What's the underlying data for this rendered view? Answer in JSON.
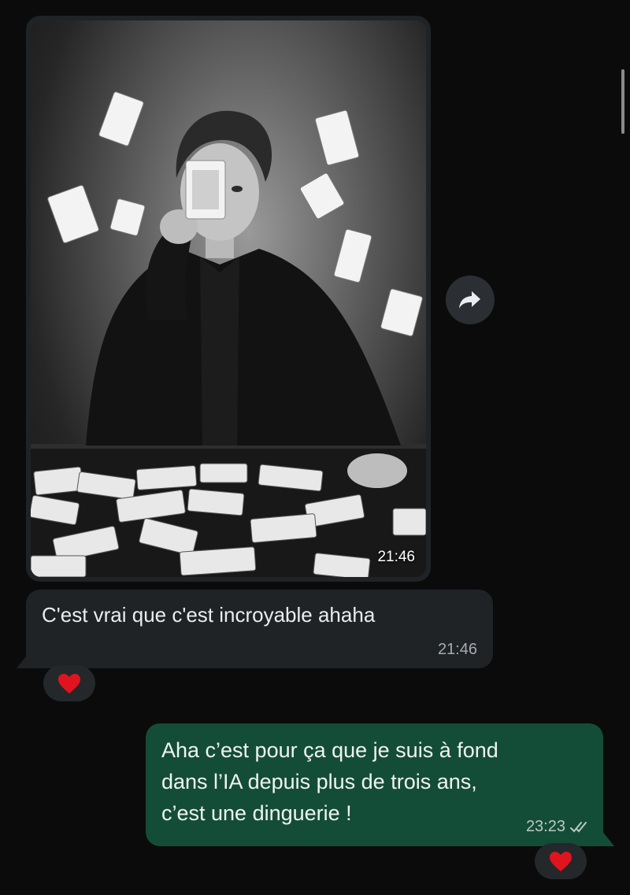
{
  "image_message": {
    "time": "21:46"
  },
  "received_message": {
    "text": "C'est vrai que c'est incroyable ahaha",
    "time": "21:46",
    "reaction": "❤️"
  },
  "sent_message": {
    "lines": [
      "Aha c’est pour ça que je suis à fond",
      "dans l’IA depuis plus de trois ans,",
      "c’est une dinguerie !"
    ],
    "time": "23:23",
    "status_icon": "double-check-icon",
    "reaction": "❤️"
  },
  "icons": {
    "forward": "forward-arrow-icon",
    "reaction": "heart"
  },
  "colors": {
    "background": "#0b0b0b",
    "received_bubble": "#1f2326",
    "sent_bubble": "#144d37",
    "heart": "#e0141e"
  }
}
